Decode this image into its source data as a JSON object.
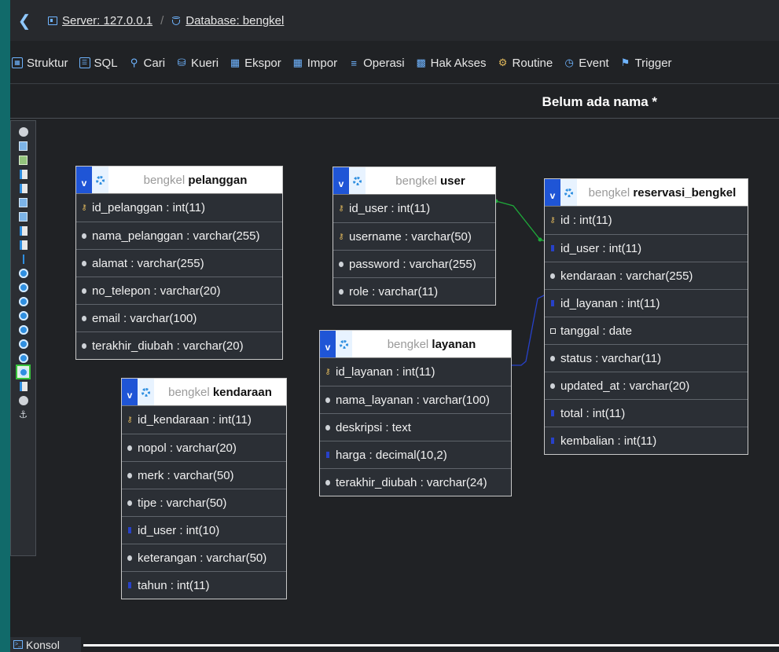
{
  "breadcrumb": {
    "server_label": "Server: 127.0.0.1",
    "separator": "/",
    "database_label": "Database: bengkel"
  },
  "menu": [
    {
      "label": "Struktur",
      "icon": "table-icon"
    },
    {
      "label": "SQL",
      "icon": "sql-icon"
    },
    {
      "label": "Cari",
      "icon": "search-icon"
    },
    {
      "label": "Kueri",
      "icon": "database-icon"
    },
    {
      "label": "Ekspor",
      "icon": "export-icon"
    },
    {
      "label": "Impor",
      "icon": "import-icon"
    },
    {
      "label": "Operasi",
      "icon": "operations-icon"
    },
    {
      "label": "Hak Akses",
      "icon": "privileges-icon"
    },
    {
      "label": "Routine",
      "icon": "routine-icon"
    },
    {
      "label": "Event",
      "icon": "event-icon"
    },
    {
      "label": "Trigger",
      "icon": "trigger-icon"
    }
  ],
  "designer_title": "Belum ada nama *",
  "database_name": "bengkel",
  "header_toggle": "v",
  "tables": {
    "pelanggan": {
      "name": "pelanggan",
      "columns": [
        {
          "text": "id_pelanggan : int(11)",
          "kind": "primary"
        },
        {
          "text": "nama_pelanggan : varchar(255)",
          "kind": "field"
        },
        {
          "text": "alamat : varchar(255)",
          "kind": "field"
        },
        {
          "text": "no_telepon : varchar(20)",
          "kind": "field"
        },
        {
          "text": "email : varchar(100)",
          "kind": "field"
        },
        {
          "text": "terakhir_diubah : varchar(20)",
          "kind": "field"
        }
      ]
    },
    "user": {
      "name": "user",
      "columns": [
        {
          "text": "id_user : int(11)",
          "kind": "primary"
        },
        {
          "text": "username : varchar(50)",
          "kind": "primary"
        },
        {
          "text": "password : varchar(255)",
          "kind": "field"
        },
        {
          "text": "role : varchar(11)",
          "kind": "field"
        }
      ]
    },
    "reservasi_bengkel": {
      "name": "reservasi_bengkel",
      "columns": [
        {
          "text": "id : int(11)",
          "kind": "primary"
        },
        {
          "text": "id_user : int(11)",
          "kind": "numeric"
        },
        {
          "text": "kendaraan : varchar(255)",
          "kind": "field"
        },
        {
          "text": "id_layanan : int(11)",
          "kind": "numeric"
        },
        {
          "text": "tanggal : date",
          "kind": "date"
        },
        {
          "text": "status : varchar(11)",
          "kind": "field"
        },
        {
          "text": "updated_at : varchar(20)",
          "kind": "field"
        },
        {
          "text": "total : int(11)",
          "kind": "numeric"
        },
        {
          "text": "kembalian : int(11)",
          "kind": "numeric"
        }
      ]
    },
    "layanan": {
      "name": "layanan",
      "columns": [
        {
          "text": "id_layanan : int(11)",
          "kind": "primary"
        },
        {
          "text": "nama_layanan : varchar(100)",
          "kind": "field"
        },
        {
          "text": "deskripsi : text",
          "kind": "field"
        },
        {
          "text": "harga : decimal(10,2)",
          "kind": "numeric"
        },
        {
          "text": "terakhir_diubah : varchar(24)",
          "kind": "field"
        }
      ]
    },
    "kendaraan": {
      "name": "kendaraan",
      "columns": [
        {
          "text": "id_kendaraan : int(11)",
          "kind": "primary"
        },
        {
          "text": "nopol : varchar(20)",
          "kind": "field"
        },
        {
          "text": "merk : varchar(50)",
          "kind": "field"
        },
        {
          "text": "tipe : varchar(50)",
          "kind": "field"
        },
        {
          "text": "id_user : int(10)",
          "kind": "numeric"
        },
        {
          "text": "keterangan : varchar(50)",
          "kind": "field"
        },
        {
          "text": "tahun : int(11)",
          "kind": "numeric"
        }
      ]
    }
  },
  "relations": [
    {
      "from": "user.id_user",
      "to": "reservasi_bengkel.id_user",
      "color": "#1fa83a"
    },
    {
      "from": "layanan.id_layanan",
      "to": "reservasi_bengkel.id_layanan",
      "color": "#2741c9"
    }
  ],
  "console_label": "Konsol",
  "colors": {
    "accent": "#6fb4ff",
    "header_toggle": "#1f55d6",
    "background": "#202225",
    "outer": "#116a6a"
  }
}
